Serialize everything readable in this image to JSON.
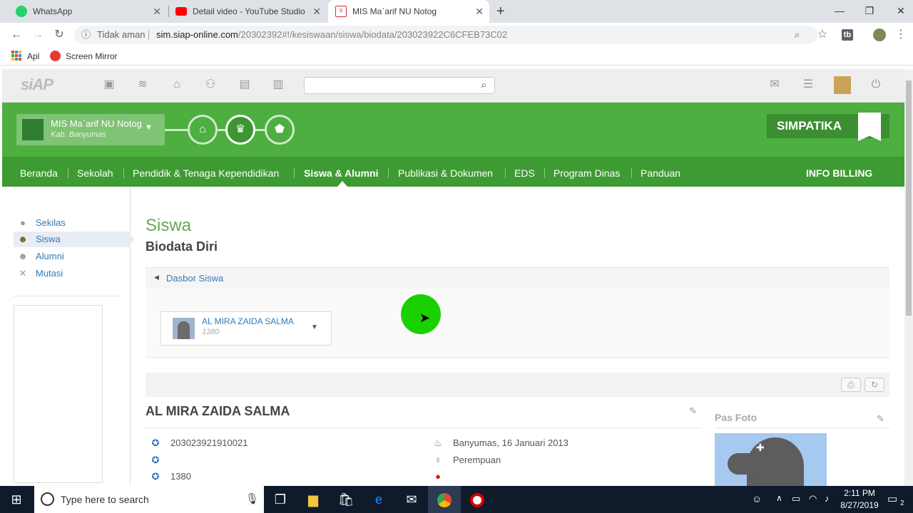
{
  "browser": {
    "tabs": [
      {
        "title": "WhatsApp",
        "color": "#25d366"
      },
      {
        "title": "Detail video - YouTube Studio",
        "color": "#ff0000"
      },
      {
        "title": "MIS Ma`arif NU Notog",
        "color": "#ffffff"
      }
    ],
    "new_tab": "+",
    "security": "Tidak aman",
    "url_host": "sim.siap-online.com",
    "url_path": "/20302392#!/kesiswaan/siswa/biodata/203023922C6CFEB73C02",
    "bookmarks": [
      "Apl",
      "Screen Mirror"
    ]
  },
  "site": {
    "logo": "siAP",
    "school_name": "MIS Ma`arif NU Notog",
    "school_region": "Kab. Banyumas",
    "simpatika": "SIMPATIKA",
    "menu": [
      "Beranda",
      "Sekolah",
      "Pendidik & Tenaga Kependidikan",
      "Siswa & Alumni",
      "Publikasi & Dokumen",
      "EDS",
      "Program Dinas",
      "Panduan"
    ],
    "active_menu": "Siswa & Alumni",
    "billing": "INFO BILLING",
    "brand_green": "#4caf3f"
  },
  "sidebar": {
    "items": [
      {
        "label": "Sekilas",
        "icon": "info-icon"
      },
      {
        "label": "Siswa",
        "icon": "student-icon"
      },
      {
        "label": "Alumni",
        "icon": "alumni-icon"
      },
      {
        "label": "Mutasi",
        "icon": "close-icon"
      }
    ],
    "active": "Siswa"
  },
  "main": {
    "title": "Siswa",
    "subtitle": "Biodata Diri",
    "back_link": "Dasbor Siswa",
    "student_select_name": "AL MIRA ZAIDA SALMA",
    "student_select_id": "1380",
    "student_name": "AL MIRA ZAIDA SALMA",
    "info_left": [
      "203023921910021",
      "",
      "1380"
    ],
    "info_right": [
      "Banyumas, 16 Januari 2013",
      "Perempuan",
      ""
    ],
    "pas_foto": "Pas Foto"
  },
  "taskbar": {
    "search_placeholder": "Type here to search",
    "time": "2:11 PM",
    "date": "8/27/2019",
    "notifications": "2"
  }
}
